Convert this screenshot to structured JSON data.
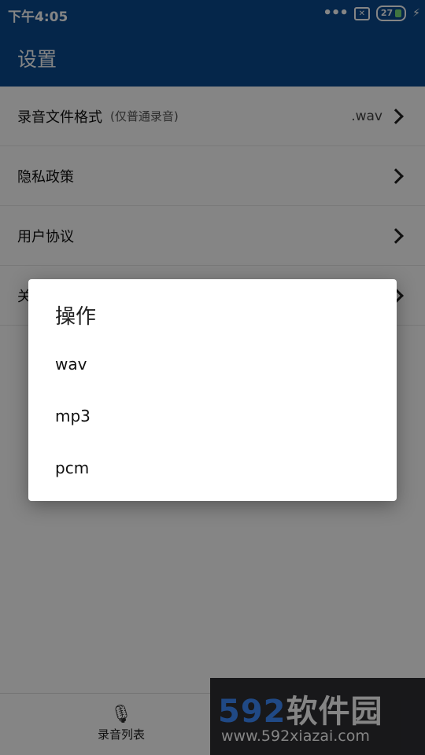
{
  "status_bar": {
    "time": "下午4:05",
    "dots": "•••",
    "notification_glyph": "✕",
    "battery": "27"
  },
  "app_bar": {
    "title": "设置"
  },
  "settings": [
    {
      "label": "录音文件格式",
      "hint": "(仅普通录音)",
      "value": ".wav"
    },
    {
      "label": "隐私政策"
    },
    {
      "label": "用户协议"
    },
    {
      "label": "关"
    }
  ],
  "dialog": {
    "title": "操作",
    "options": [
      "wav",
      "mp3",
      "pcm"
    ]
  },
  "bottom_nav": {
    "items": [
      {
        "label": "录音列表",
        "icon": "mic-list-icon"
      }
    ]
  },
  "watermark": {
    "number": "592",
    "brand": "软件园",
    "url": "www.592xiazai.com"
  },
  "colors": {
    "primary": "#0a4a8f",
    "scrim": "rgba(0,0,0,0.48)"
  }
}
